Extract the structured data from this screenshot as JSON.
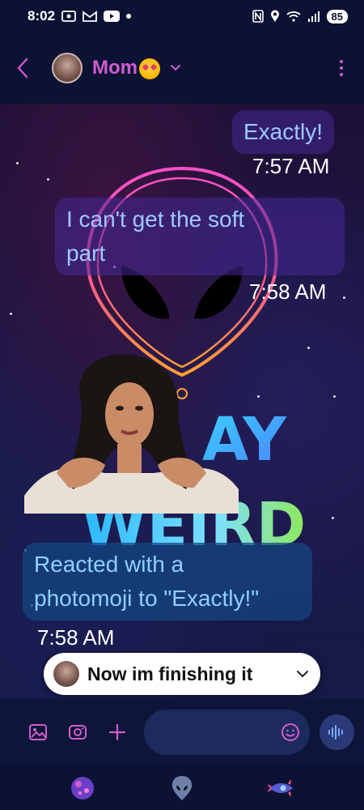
{
  "status_bar": {
    "time": "8:02",
    "battery": "85"
  },
  "header": {
    "contact_name": "Mom",
    "contact_emoji": "smiling-face-with-hearts"
  },
  "messages": [
    {
      "type": "sent",
      "text": "Exactly!",
      "time": "7:57 AM"
    },
    {
      "type": "sent",
      "lines": [
        "I can't get the soft",
        "part"
      ],
      "time": "7:58 AM"
    },
    {
      "type": "photomoji",
      "time": ""
    },
    {
      "type": "received",
      "lines": [
        "Reacted with a",
        "photomoji to \"Exactly!\""
      ],
      "time": "7:58 AM"
    }
  ],
  "preview": {
    "text": "Now im finishing it"
  },
  "colors": {
    "accent": "#d25ccf",
    "header_bg": "#0b1234",
    "sent_bubble": "#4628a0",
    "received_bubble": "#144682"
  },
  "icons": {
    "back": "chevron-left-icon",
    "more": "more-vertical-icon",
    "gallery": "image-icon",
    "camera": "camera-icon",
    "add": "plus-icon",
    "emoji": "emoji-icon",
    "voice": "voice-wave-icon"
  }
}
